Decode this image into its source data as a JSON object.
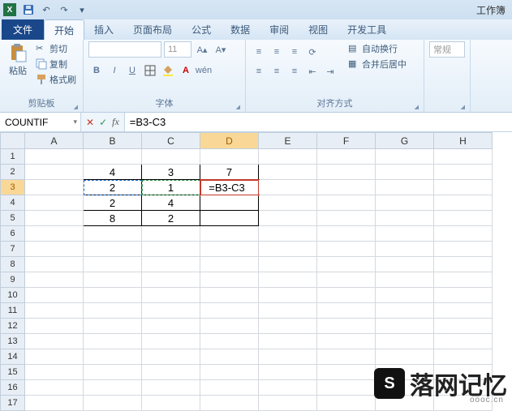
{
  "titlebar": {
    "workbook": "工作簿"
  },
  "tabs": {
    "file": "文件",
    "home": "开始",
    "insert": "插入",
    "layout": "页面布局",
    "formulas": "公式",
    "data": "数据",
    "review": "审阅",
    "view": "视图",
    "dev": "开发工具"
  },
  "ribbon": {
    "clipboard": {
      "paste": "粘贴",
      "cut": "剪切",
      "copy": "复制",
      "format_painter": "格式刷",
      "group": "剪贴板"
    },
    "font": {
      "size": "11",
      "group": "字体"
    },
    "align": {
      "wrap": "自动换行",
      "merge": "合并后居中",
      "group": "对齐方式"
    },
    "number": {
      "general": "常规"
    }
  },
  "formula_bar": {
    "name": "COUNTIF",
    "formula": "=B3-C3"
  },
  "columns": [
    "A",
    "B",
    "C",
    "D",
    "E",
    "F",
    "G",
    "H"
  ],
  "rows_count": 17,
  "active": {
    "row": 3,
    "col": "D",
    "display": "=B3-C3"
  },
  "cells": {
    "B2": "4",
    "C2": "3",
    "D2": "7",
    "B3": "2",
    "C3": "1",
    "B4": "2",
    "C4": "4",
    "B5": "8",
    "C5": "2"
  },
  "watermark": {
    "text": "落网记忆",
    "url": "oooc.cn"
  },
  "chart_data": {
    "type": "table",
    "columns": [
      "B",
      "C",
      "D"
    ],
    "rows": [
      {
        "B": 4,
        "C": 3,
        "D": 7
      },
      {
        "B": 2,
        "C": 1,
        "D": "=B3-C3"
      },
      {
        "B": 2,
        "C": 4,
        "D": null
      },
      {
        "B": 8,
        "C": 2,
        "D": null
      }
    ]
  }
}
